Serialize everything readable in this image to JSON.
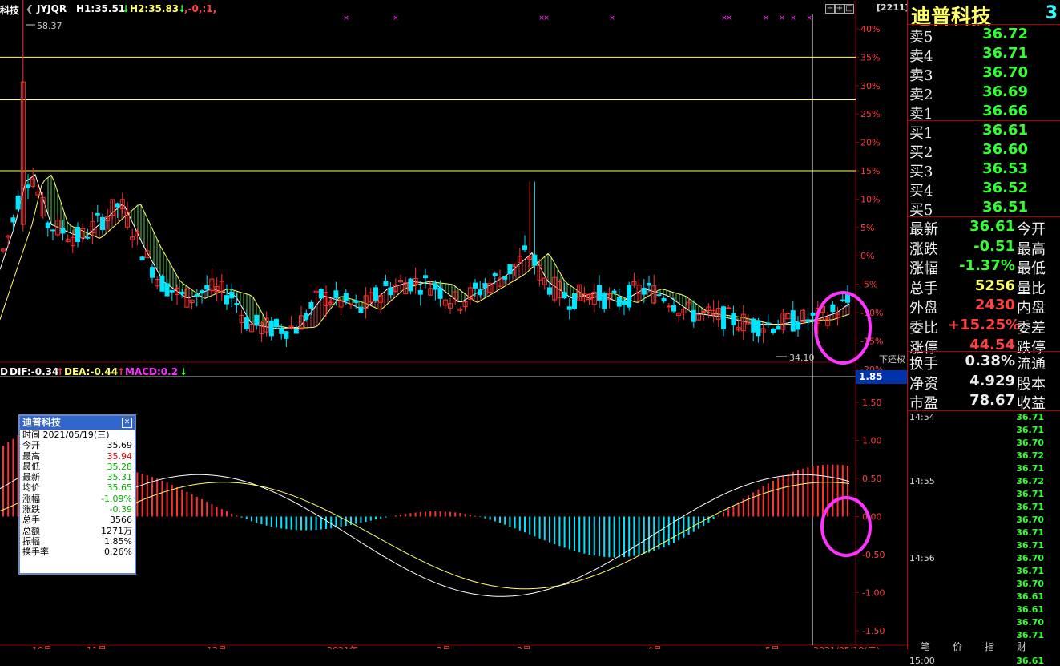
{
  "chart_header": {
    "name_fragment": "科技",
    "indicator": "JYJQR",
    "h1": "H1:35.51",
    "h1_arrow": "↓",
    "h2": "H2:35.83",
    "h2_arrow": "↓",
    "extra": ",-0,:1,",
    "code_box": "[2211]",
    "max_label": "58.37",
    "min_label": "34.10",
    "adjust_label": "下还权"
  },
  "macd_header": {
    "prefix": "D",
    "dif": "DIF:-0.34",
    "dif_arrow": "↑",
    "dea": "DEA:-0.44",
    "dea_arrow": "↑",
    "macd": "MACD:0.2",
    "macd_arrow": "↓",
    "box_value": "1.85"
  },
  "pct_axis": [
    "40%",
    "35%",
    "30%",
    "25%",
    "20%",
    "15%",
    "10%",
    "5%",
    "0%",
    "-5%",
    "-10%",
    "-15%",
    "-20%"
  ],
  "macd_axis": [
    "1.50",
    "1.00",
    "0.50",
    "0.00",
    "-0.50",
    "-1.00",
    "-1.50"
  ],
  "bottom_axis": [
    "10月",
    "11月",
    "12月",
    "2021年",
    "2月",
    "3月",
    "4月",
    "5月",
    "2021/05/19(三)"
  ],
  "colors": {
    "up": "#ff3030",
    "down": "#00e5ff",
    "ma": "#ffff66",
    "grid": "#8b0000",
    "highlight": "#ff33ff"
  },
  "quote_panel": {
    "title": "迪普科技",
    "page": "3",
    "asks": [
      {
        "label": "卖5",
        "price": "36.72"
      },
      {
        "label": "卖4",
        "price": "36.71"
      },
      {
        "label": "卖3",
        "price": "36.70"
      },
      {
        "label": "卖2",
        "price": "36.69"
      },
      {
        "label": "卖1",
        "price": "36.66"
      }
    ],
    "bids": [
      {
        "label": "买1",
        "price": "36.61"
      },
      {
        "label": "买2",
        "price": "36.60"
      },
      {
        "label": "买3",
        "price": "36.53"
      },
      {
        "label": "买4",
        "price": "36.52"
      },
      {
        "label": "买5",
        "price": "36.51"
      }
    ],
    "stats": [
      {
        "label": "最新",
        "value": "36.61",
        "color": "#3f3",
        "label2": "今开"
      },
      {
        "label": "涨跌",
        "value": "-0.51",
        "color": "#3f3",
        "label2": "最高"
      },
      {
        "label": "涨幅",
        "value": "-1.37%",
        "color": "#3f3",
        "label2": "最低"
      },
      {
        "label": "总手",
        "value": "5256",
        "color": "#ffff66",
        "label2": "量比"
      },
      {
        "label": "外盘",
        "value": "2430",
        "color": "#ff4040",
        "label2": "内盘"
      },
      {
        "label": "委比",
        "value": "+15.25%",
        "color": "#ff4040",
        "label2": "委差"
      },
      {
        "label": "涨停",
        "value": "44.54",
        "color": "#ff4040",
        "label2": "跌停"
      }
    ],
    "stats2": [
      {
        "label": "换手",
        "value": "0.38%",
        "label2": "流通"
      },
      {
        "label": "净资",
        "value": "4.929",
        "label2": "股本"
      },
      {
        "label": "市盈",
        "value": "78.67",
        "label2": "收益"
      }
    ],
    "ticks": [
      {
        "time": "14:54",
        "prices": [
          "36.71",
          "36.71",
          "36.70",
          "36.72",
          "36.71"
        ]
      },
      {
        "time": "14:55",
        "prices": [
          "36.72",
          "36.71",
          "36.71",
          "36.70",
          "36.71",
          "36.71"
        ]
      },
      {
        "time": "14:56",
        "prices": [
          "36.70",
          "36.71",
          "36.70",
          "36.61",
          "36.61",
          "36.70",
          "36.71"
        ]
      },
      {
        "time": "15:00",
        "prices": [
          "36.61"
        ]
      }
    ],
    "bottom_tabs": [
      "笔",
      "价",
      "指",
      "财"
    ]
  },
  "popup": {
    "title": "迪普科技",
    "date": "时间 2021/05/19(三)",
    "rows": [
      {
        "k": "今开",
        "v": "35.69",
        "c": "#000"
      },
      {
        "k": "最高",
        "v": "35.94",
        "c": "#e00"
      },
      {
        "k": "最低",
        "v": "35.28",
        "c": "#0a0"
      },
      {
        "k": "最新",
        "v": "35.31",
        "c": "#0a0"
      },
      {
        "k": "均价",
        "v": "35.65",
        "c": "#0a0"
      },
      {
        "k": "涨幅",
        "v": "-1.09%",
        "c": "#0a0"
      },
      {
        "k": "涨跌",
        "v": "-0.39",
        "c": "#0a0"
      },
      {
        "k": "总手",
        "v": "3566",
        "c": "#000"
      },
      {
        "k": "总额",
        "v": "1271万",
        "c": "#000"
      },
      {
        "k": "振幅",
        "v": "1.85%",
        "c": "#000"
      },
      {
        "k": "换手率",
        "v": "0.26%",
        "c": "#000"
      }
    ]
  },
  "chart_data": {
    "type": "candlestick",
    "price_points": [
      {
        "t": "start",
        "close": 39.5
      },
      {
        "t": "peak",
        "high": 58.37,
        "close": 45.5
      },
      {
        "t": "Oct",
        "close": 42
      },
      {
        "t": "Nov",
        "close": 43.5
      },
      {
        "t": "Dec",
        "close": 37.5
      },
      {
        "t": "2021",
        "close": 38
      },
      {
        "t": "Feb",
        "close": 38
      },
      {
        "t": "Mar",
        "high": 45,
        "close": 40
      },
      {
        "t": "Apr",
        "close": 39
      },
      {
        "t": "May",
        "low": 34.1,
        "close": 35.31
      },
      {
        "t": "end",
        "close": 36.61
      }
    ],
    "pct_range": [
      -20,
      40
    ],
    "horizontal_lines_pct": [
      35,
      27.5,
      15
    ],
    "macd": {
      "dif_last": -0.34,
      "dea_last": -0.44,
      "macd_last": 0.2,
      "range": [
        -1.5,
        1.5
      ]
    }
  }
}
